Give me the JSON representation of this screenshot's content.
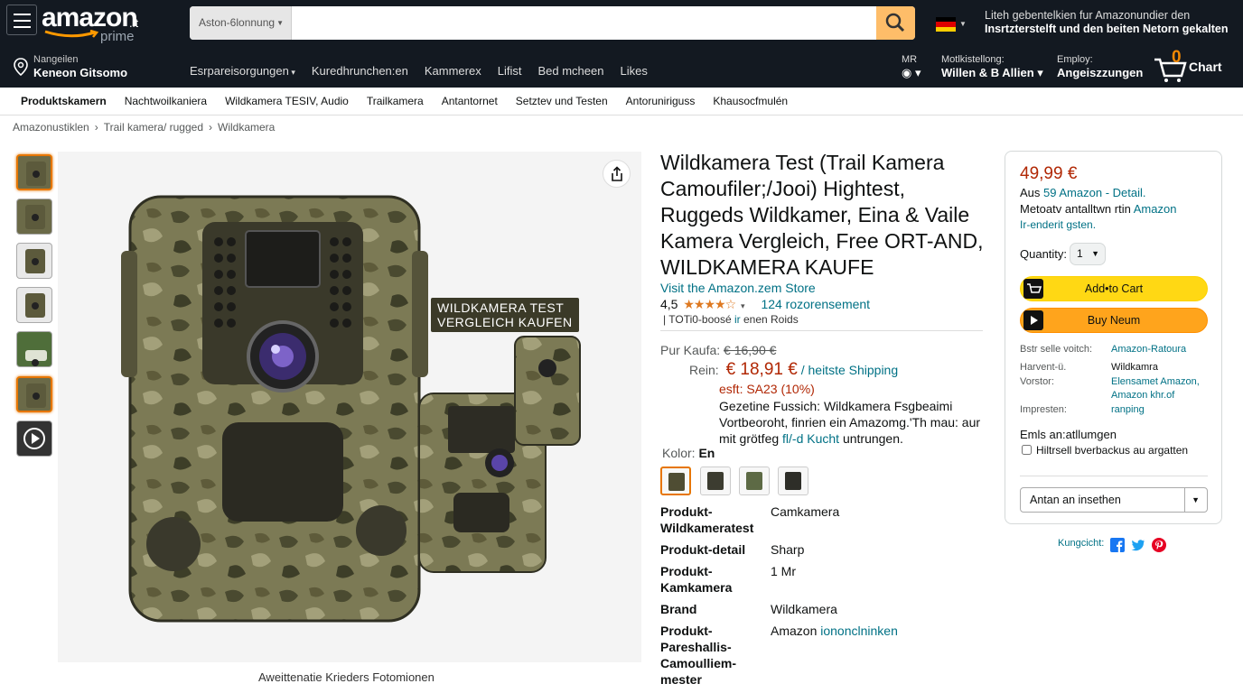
{
  "header": {
    "logo_text": "amazon",
    "logo_tld": ".it",
    "logo_sub": "prime",
    "search_category": "Aston-6lonnung",
    "search_placeholder": "",
    "top_message_line1": "Liteh gebentelkien fur Amazonundier den",
    "top_message_line2": "Insrtzterstelft und den beiten Netorn gekalten",
    "deliver_line1": "Nangeilen",
    "deliver_line2": "Keneon Gitsomo",
    "nav_links": [
      "Esrpareisorgungen",
      "Kuredhrunchen:en",
      "Kammerex",
      "Lifist",
      "Bed mcheen",
      "Likes"
    ],
    "acct1_small": "MR",
    "acct2_small": "Motlkistellong:",
    "acct2_big": "Willen & B Allien",
    "acct3_small": "Employ:",
    "acct3_big": "Angeiszzungen",
    "cart_count": "0",
    "cart_label": "Chart"
  },
  "category_bar": [
    "Produktskamern",
    "Nachtwoilkaniera",
    "Wildkamera TESIV, Audio",
    "Trailkamera",
    "Antantornet",
    "Setztev und Testen",
    "Antoruniriguss",
    "Khausocfmulén"
  ],
  "breadcrumb": [
    "Amazonustiklen",
    "Trail kamera/ rugged",
    "Wildkamera"
  ],
  "gallery": {
    "overlay_line1": "WILDKAMERA TEST",
    "overlay_line2": "VERGLEICH KAUFEN",
    "caption": "Aweittenatie Krieders Fotomionen"
  },
  "product": {
    "title": "Wildkamera Test (Trail Kamera Camoufiler;/Jooi) Hightest, Ruggeds Wildkamer, Eina & Vaile Kamera Vergleich, Free ORT-AND, WILDKAMERA KAUFE",
    "store_link": "Visit the Amazon.zem Store",
    "rating_value": "4,5",
    "rating_stars": "★★★★☆",
    "rating_reviews": "124 rozorensement",
    "badge_prefix": "TOTi0-boosé",
    "badge_mid": "ir",
    "badge_suffix": "enen Roids",
    "price_label1": "Pur Kaufa:",
    "price_old": "€ 16,90 €",
    "price_label2": "Rein:",
    "price_current": "€ 18,91 €",
    "shipping": "/ heitste Shipping",
    "savings": "esft: SA23 (10%)",
    "desc_line1": "Gezetine Fussich: Wildkamera Fsgbeaimi",
    "desc_line2": "Vortbeoroht, finrien ein Amazomg.'Th mau: aur",
    "desc_line3_a": "mit grötfeg",
    "desc_line3_link": "fl/-d Kucht",
    "desc_line3_b": "untrungen.",
    "color_label": "Kolor:",
    "color_value": "En",
    "specs": [
      {
        "key": "Produkt-Wildkameratest",
        "value": "Camkamera"
      },
      {
        "key": "Produkt-detail",
        "value": "Sharp"
      },
      {
        "key": "Produkt-Kamkamera",
        "value": "1 Mr"
      },
      {
        "key": "Brand",
        "value": "Wildkamera"
      },
      {
        "key": "Produkt-Pareshallis-Camoulliem-mester",
        "value_a": "Amazon",
        "value_b": "iononclninken"
      }
    ]
  },
  "buybox": {
    "price": "49,99 €",
    "aus_a": "Aus",
    "aus_link": "59 Amazon - Detail.",
    "line2_a": "Metoatv antalltwn rtin",
    "line2_link": "Amazon",
    "line3": "Ir-enderit gsten.",
    "qty_label": "Quantity:",
    "qty_value": "1",
    "add_to_cart": "Add•to Cart",
    "buy_now": "Buy Neum",
    "info": [
      {
        "k": "Bstr selle voitch:",
        "v": "Amazon-Ratoura"
      },
      {
        "k": "Harvent-ü.",
        "v": "Wildkamra"
      },
      {
        "k": "Vorstor:",
        "v": "Elensamet Amazon,"
      },
      {
        "k": "",
        "v": "Amazon khr.of"
      },
      {
        "k": "Impresten:",
        "v": "ranping"
      }
    ],
    "gift_heading": "Emls an:atllumgen",
    "gift_option": "Hiltrsell bverbackus au argatten",
    "list_select": "Antan an insethen",
    "share_label": "Kungcicht:"
  },
  "colors": {
    "nav_bg": "#131921",
    "search_btn": "#febd69",
    "cart_btn": "#ffd814",
    "buy_btn": "#ffa41c",
    "price": "#b12704",
    "link": "#007185",
    "star": "#de7921",
    "selection": "#e77600"
  },
  "icons": [
    "menu-icon",
    "search-icon",
    "germany-flag-icon",
    "location-pin-icon",
    "cart-icon",
    "share-icon",
    "play-icon",
    "facebook-icon",
    "twitter-icon",
    "pinterest-icon"
  ]
}
